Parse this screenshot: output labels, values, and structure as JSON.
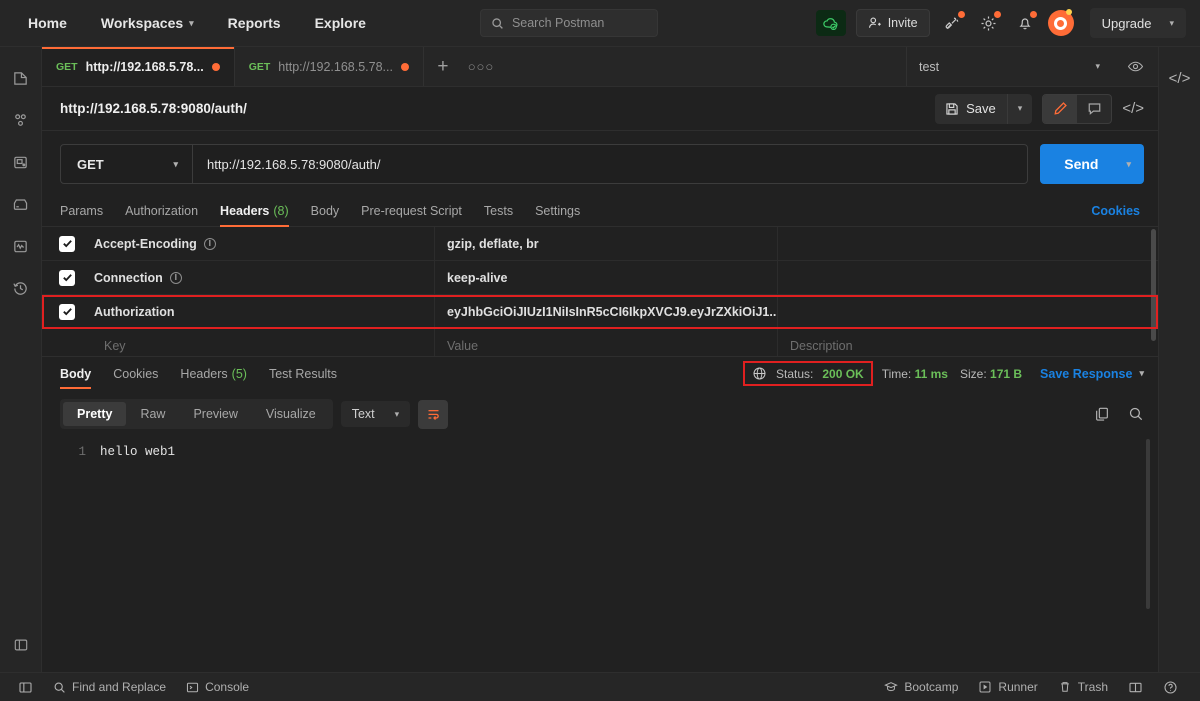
{
  "header": {
    "nav": [
      {
        "label": "Home",
        "has_caret": false
      },
      {
        "label": "Workspaces",
        "has_caret": true
      },
      {
        "label": "Reports",
        "has_caret": false
      },
      {
        "label": "Explore",
        "has_caret": false
      }
    ],
    "search_placeholder": "Search Postman",
    "invite_label": "Invite",
    "upgrade_label": "Upgrade",
    "icons": [
      "cloud-sync-icon",
      "invite-icon",
      "satellite-icon",
      "settings-gear-icon",
      "notifications-bell-icon",
      "user-avatar"
    ]
  },
  "rail": {
    "icons": [
      "collections-icon",
      "apis-icon",
      "environments-icon",
      "mock-servers-icon",
      "monitors-icon",
      "history-icon",
      "trash-panel-icon"
    ]
  },
  "tabs": {
    "items": [
      {
        "method": "GET",
        "name": "http://192.168.5.78...",
        "unsaved": true,
        "active": true
      },
      {
        "method": "GET",
        "name": "http://192.168.5.78...",
        "unsaved": true,
        "active": false
      }
    ],
    "add_label": "+",
    "more_label": "○○○",
    "environment": "test"
  },
  "request": {
    "title": "http://192.168.5.78:9080/auth/",
    "save_label": "Save",
    "method": "GET",
    "url": "http://192.168.5.78:9080/auth/",
    "send_label": "Send",
    "tabs": [
      {
        "label": "Params",
        "count": "",
        "active": false
      },
      {
        "label": "Authorization",
        "count": "",
        "active": false
      },
      {
        "label": "Headers",
        "count": "(8)",
        "active": true
      },
      {
        "label": "Body",
        "count": "",
        "active": false
      },
      {
        "label": "Pre-request Script",
        "count": "",
        "active": false
      },
      {
        "label": "Tests",
        "count": "",
        "active": false
      },
      {
        "label": "Settings",
        "count": "",
        "active": false
      }
    ],
    "cookies_link": "Cookies"
  },
  "headers_table": {
    "placeholder_key": "Key",
    "placeholder_value": "Value",
    "placeholder_desc": "Description",
    "rows": [
      {
        "checked": true,
        "key": "Accept-Encoding",
        "info": true,
        "value": "gzip, deflate, br",
        "highlight": false
      },
      {
        "checked": true,
        "key": "Connection",
        "info": true,
        "value": "keep-alive",
        "highlight": false
      },
      {
        "checked": true,
        "key": "Authorization",
        "info": false,
        "value": "eyJhbGciOiJIUzI1NiIsInR5cCI6IkpXVCJ9.eyJrZXkiOiJ1...",
        "highlight": true
      }
    ]
  },
  "response": {
    "tabs": [
      {
        "label": "Body",
        "count": "",
        "active": true
      },
      {
        "label": "Cookies",
        "count": "",
        "active": false
      },
      {
        "label": "Headers",
        "count": "(5)",
        "active": false
      },
      {
        "label": "Test Results",
        "count": "",
        "active": false
      }
    ],
    "status_label": "Status:",
    "status_value": "200 OK",
    "time_label": "Time:",
    "time_value": "11 ms",
    "size_label": "Size:",
    "size_value": "171 B",
    "save_response_label": "Save Response",
    "view_modes": [
      {
        "label": "Pretty",
        "active": true
      },
      {
        "label": "Raw",
        "active": false
      },
      {
        "label": "Preview",
        "active": false
      },
      {
        "label": "Visualize",
        "active": false
      }
    ],
    "format": "Text",
    "wrap_icon": "word-wrap-icon",
    "copy_icon": "copy-icon",
    "search_icon": "search-icon",
    "body_lines": [
      {
        "num": "1",
        "text": "hello web1"
      }
    ]
  },
  "footer": {
    "left": [
      {
        "label": "Find and Replace",
        "icon": "search-icon"
      },
      {
        "label": "Console",
        "icon": "console-icon"
      }
    ],
    "right": [
      {
        "label": "Bootcamp",
        "icon": "bootcamp-icon"
      },
      {
        "label": "Runner",
        "icon": "runner-icon"
      },
      {
        "label": "Trash",
        "icon": "trash-icon"
      },
      {
        "label": "",
        "icon": "layout-icon"
      },
      {
        "label": "",
        "icon": "help-icon"
      }
    ]
  },
  "colors": {
    "accent": "#ff6c37",
    "send_blue": "#1a82e2",
    "success_green": "#6bbf59",
    "highlight_red": "#e02020"
  }
}
